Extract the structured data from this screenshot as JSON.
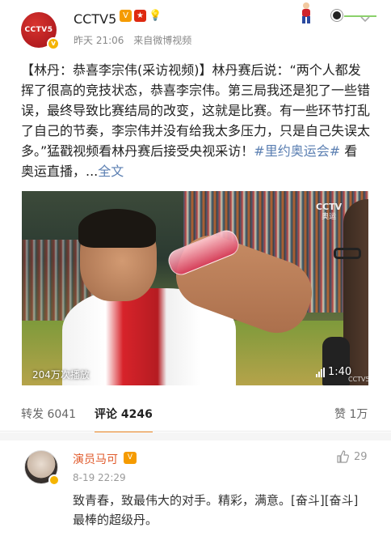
{
  "post": {
    "author": "CCTV5",
    "time": "昨天 21:06",
    "source": "来自微博视频",
    "text_main": "【林丹：恭喜李宗伟(采访视频)】林丹赛后说：“两个人都发挥了很高的竞技状态，恭喜李宗伟。第三局我还是犯了一些错误，最终导致比赛结局的改变，这就是比赛。有一些环节打乱了自己的节奏，李宗伟并没有给我太多压力，只是自己失误太多。”猛戳视频看林丹赛后接受央视采访！",
    "hashtag": "#里约奥运会#",
    "text_tail": " 看奥运直播，...",
    "more_link": "全文"
  },
  "video": {
    "views": "204万次播放",
    "duration": "1:40",
    "watermark": "CCTV",
    "watermark_sub": "奥运",
    "bottom_mark": "CCTV5"
  },
  "stats": {
    "repost": "转发 6041",
    "comment": "评论 4246",
    "like": "赞 1万"
  },
  "comment": {
    "user": "演员马可",
    "time": "8-19 22:29",
    "likes": "29",
    "text": "致青春，致最伟大的对手。精彩，满意。[奋斗][奋斗]最棒的超级丹。"
  },
  "icons": [
    "vip-icon",
    "china-flag-icon",
    "lightbulb-icon",
    "chevron-down-icon",
    "thumbs-up-icon",
    "signal-bars-icon"
  ],
  "colors": {
    "link": "#5b7fb2",
    "highlight_name": "#e0592a",
    "tab_underline": "#f28b26",
    "vip": "#f59b00"
  }
}
